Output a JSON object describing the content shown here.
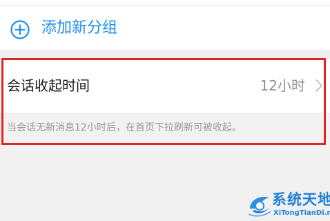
{
  "add_group": {
    "label": "添加新分组",
    "icon": "plus-circle-icon",
    "accent_color": "#1a8ff0"
  },
  "conversation_collapse": {
    "title": "会话收起时间",
    "value": "12小时",
    "chevron_icon": "chevron-right-icon",
    "description": "当会话无新消息12小时后，在首页下拉刷新可被收起。"
  },
  "highlight": {
    "color": "#e32222"
  },
  "watermark": {
    "title": "系统天地",
    "subtitle": "XiTongTianDi.net",
    "color": "#1f7fd6"
  }
}
